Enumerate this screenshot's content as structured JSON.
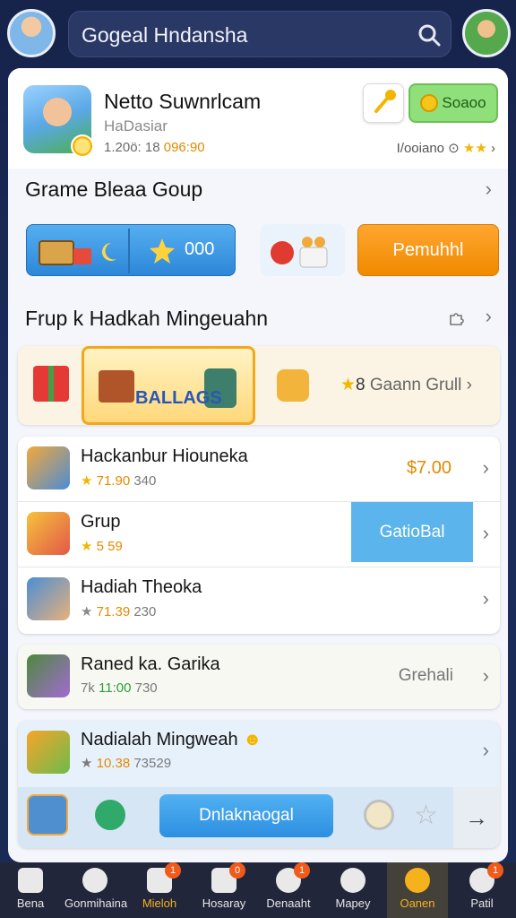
{
  "header": {
    "search_text": "Gogeal Hndansha"
  },
  "profile": {
    "name": "Netto Suwnrlcam",
    "subtitle": "HaDasiar",
    "stats_prefix": "1.20ö: 18",
    "stats_value": "096:90",
    "coins_label": "Soaoo",
    "right_text": "I/ooiano ⊙"
  },
  "section1": {
    "title": "Grame Bleaa Goup"
  },
  "quick": {
    "blue_value": "000",
    "orange_label": "Pemuhhl"
  },
  "section2": {
    "title": "Frup k Hadkah Mingeuahn"
  },
  "bonus": {
    "label": "BALLAGS",
    "right_num": "8",
    "right_text": "Gaann Grull"
  },
  "list": [
    {
      "title": "Hackanbur Hiouneka",
      "rating": "★",
      "value": "71.90",
      "count": "340",
      "price": "$7.00"
    },
    {
      "title": "Grup",
      "rating": "★",
      "value": "5 59",
      "count": "",
      "button": "GatioBal"
    },
    {
      "title": "Hadiah Theoka",
      "rating": "★",
      "value": "71.39",
      "count": "230"
    }
  ],
  "card2": {
    "title": "Raned ka. Garika",
    "meta_prefix": "7k",
    "value": "11:00",
    "count": "730",
    "right_label": "Grehali"
  },
  "card3": {
    "title": "Nadialah Mingweah",
    "rating": "★",
    "value": "10.38",
    "count": "73529",
    "button": "Dnlaknaogal"
  },
  "nav": [
    {
      "label": "Bena",
      "badge": ""
    },
    {
      "label": "Gonmihaina",
      "badge": ""
    },
    {
      "label": "Mieloh",
      "badge": "1"
    },
    {
      "label": "Hosaray",
      "badge": "0"
    },
    {
      "label": "Denaaht",
      "badge": "1"
    },
    {
      "label": "Mapey",
      "badge": ""
    },
    {
      "label": "Oanen",
      "badge": ""
    },
    {
      "label": "Patil",
      "badge": "1"
    }
  ]
}
